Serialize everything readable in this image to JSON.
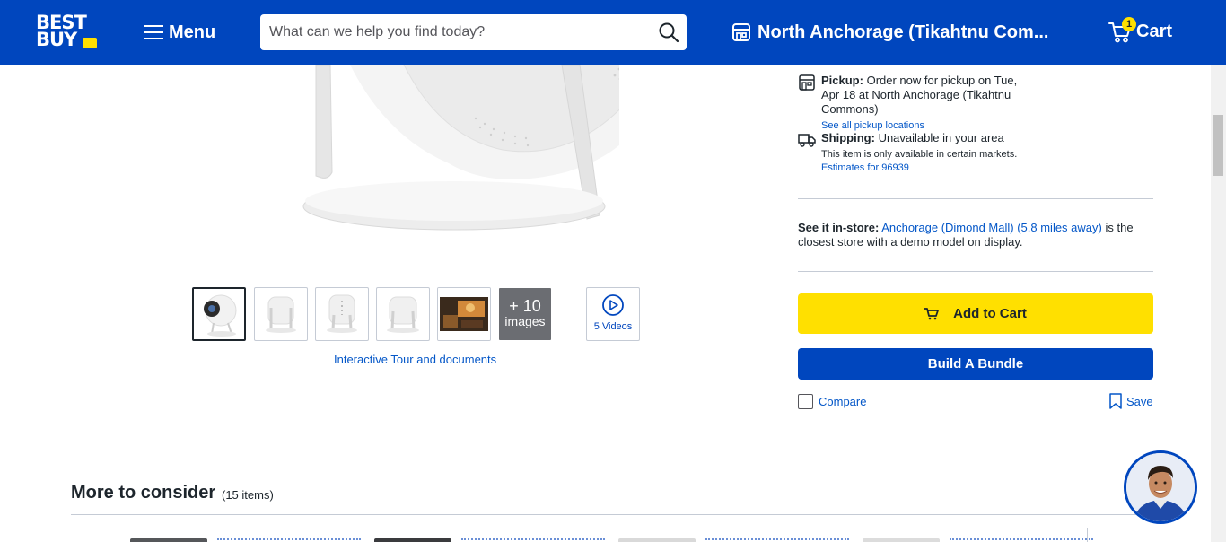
{
  "header": {
    "logo_line1": "BEST",
    "logo_line2": "BUY",
    "menu_label": "Menu",
    "search_placeholder": "What can we help you find today?",
    "store_label": "North Anchorage (Tikahtnu Com...",
    "cart_label": "Cart",
    "cart_count": "1",
    "colors": {
      "header_bg": "#0046be",
      "accent_yellow": "#ffe000"
    }
  },
  "gallery": {
    "more_images_count": "+ 10",
    "more_images_label": "images",
    "videos_label": "5 Videos",
    "interactive_link": "Interactive Tour and documents"
  },
  "fulfillment": {
    "pickup_label": "Pickup:",
    "pickup_text": "Order now for pickup on Tue, Apr 18 at North Anchorage (Tikahtnu Commons)",
    "pickup_link": "See all pickup locations",
    "shipping_label": "Shipping:",
    "shipping_text": "Unavailable in your area",
    "shipping_note": "This item is only available in certain markets.",
    "shipping_link": "Estimates for 96939"
  },
  "see_in_store": {
    "label": "See it in-store:",
    "store_link": "Anchorage (Dimond Mall) (5.8 miles away)",
    "text_after": "is the closest store with a demo model on display."
  },
  "actions": {
    "add_to_cart": "Add to Cart",
    "build_bundle": "Build A Bundle",
    "compare": "Compare",
    "save": "Save"
  },
  "more_to_consider": {
    "title": "More to consider",
    "count": "(15 items)"
  },
  "icons": [
    "hamburger-icon",
    "search-icon",
    "store-icon",
    "cart-icon",
    "pickup-icon",
    "shipping-icon",
    "play-icon",
    "cart-small-icon",
    "bookmark-icon",
    "checkbox-icon"
  ]
}
